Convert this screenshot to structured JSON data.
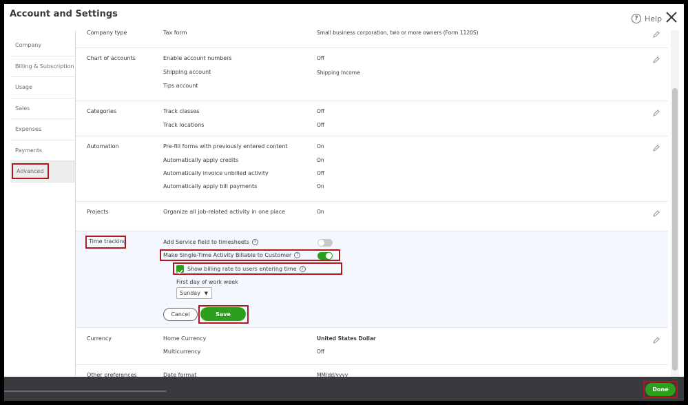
{
  "header": {
    "title": "Account and Settings",
    "help_label": "Help"
  },
  "sidebar": {
    "items": [
      {
        "label": "Company"
      },
      {
        "label": "Billing & Subscription"
      },
      {
        "label": "Usage"
      },
      {
        "label": "Sales"
      },
      {
        "label": "Expenses"
      },
      {
        "label": "Payments"
      },
      {
        "label": "Advanced"
      }
    ],
    "active": "Advanced"
  },
  "sections": {
    "company_type": {
      "label": "Company type",
      "rows": [
        {
          "label": "Tax form",
          "value": "Small business corporation, two or more owners (Form 1120S)"
        }
      ]
    },
    "chart_of_accounts": {
      "label": "Chart of accounts",
      "rows": [
        {
          "label": "Enable account numbers",
          "value": "Off"
        },
        {
          "label": "Shipping account",
          "value": "Shipping Income"
        },
        {
          "label": "Tips account",
          "value": ""
        }
      ]
    },
    "categories": {
      "label": "Categories",
      "rows": [
        {
          "label": "Track classes",
          "value": "Off"
        },
        {
          "label": "Track locations",
          "value": "Off"
        }
      ]
    },
    "automation": {
      "label": "Automation",
      "rows": [
        {
          "label": "Pre-fill forms with previously entered content",
          "value": "On"
        },
        {
          "label": "Automatically apply credits",
          "value": "On"
        },
        {
          "label": "Automatically invoice unbilled activity",
          "value": "Off"
        },
        {
          "label": "Automatically apply bill payments",
          "value": "On"
        }
      ]
    },
    "projects": {
      "label": "Projects",
      "rows": [
        {
          "label": "Organize all job-related activity in one place",
          "value": "On"
        }
      ]
    },
    "time_tracking": {
      "label": "Time tracking",
      "add_service_field": {
        "label": "Add Service field to timesheets",
        "on": false
      },
      "make_billable": {
        "label": "Make Single-Time Activity Billable to Customer",
        "on": true
      },
      "show_billing_rate": {
        "label": "Show billing rate to users entering time",
        "checked": true
      },
      "first_day": {
        "label": "First day of work week",
        "value": "Sunday"
      },
      "cancel_label": "Cancel",
      "save_label": "Save"
    },
    "currency": {
      "label": "Currency",
      "rows": [
        {
          "label": "Home Currency",
          "value": "United States Dollar"
        },
        {
          "label": "Multicurrency",
          "value": "Off"
        }
      ]
    },
    "other_preferences": {
      "label": "Other preferences",
      "rows": [
        {
          "label": "Date format",
          "value": "MM/dd/yyyy"
        }
      ]
    }
  },
  "footer": {
    "done_label": "Done"
  },
  "colors": {
    "accent_green": "#2ca01c",
    "highlight_red": "#b3161c",
    "footer_bg": "#393a3d",
    "time_tracking_bg": "#f4f7fd"
  }
}
